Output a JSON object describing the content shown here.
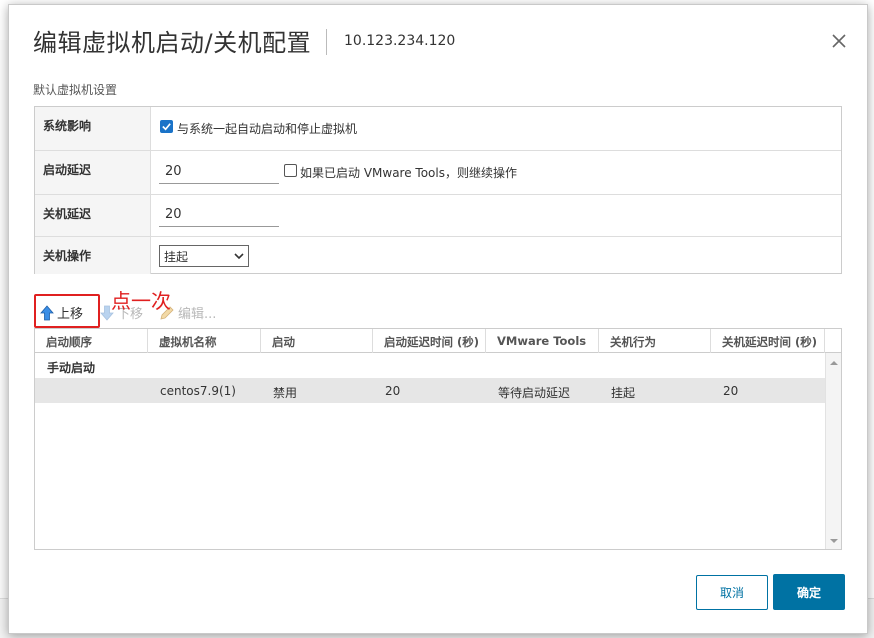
{
  "dialog": {
    "title": "编辑虚拟机启动/关机配置",
    "host": "10.123.234.120"
  },
  "defaults": {
    "section_label": "默认虚拟机设置",
    "system_effect": {
      "label": "系统影响",
      "checkbox_text": "与系统一起自动启动和停止虚拟机",
      "checked": true
    },
    "start_delay": {
      "label": "启动延迟",
      "value": "20",
      "checkbox_text": "如果已启动 VMware Tools，则继续操作",
      "checked": false
    },
    "stop_delay": {
      "label": "关机延迟",
      "value": "20"
    },
    "stop_action": {
      "label": "关机操作",
      "selected": "挂起"
    }
  },
  "toolbar": {
    "move_up": "上移",
    "move_down": "下移",
    "edit": "编辑..."
  },
  "annotation": "点一次",
  "table": {
    "columns": [
      "启动顺序",
      "虚拟机名称",
      "启动",
      "启动延迟时间 (秒)",
      "VMware Tools",
      "关机行为",
      "关机延迟时间 (秒)"
    ],
    "group": "手动启动",
    "rows": [
      {
        "order": "",
        "name": "centos7.9(1)",
        "startup": "禁用",
        "start_delay": "20",
        "vmware_tools": "等待启动延迟",
        "shutdown_action": "挂起",
        "shutdown_delay": "20"
      }
    ]
  },
  "buttons": {
    "cancel": "取消",
    "ok": "确定"
  },
  "colors": {
    "primary": "#0072a3",
    "annotation": "#e02020",
    "checkbox": "#1a73c8"
  }
}
